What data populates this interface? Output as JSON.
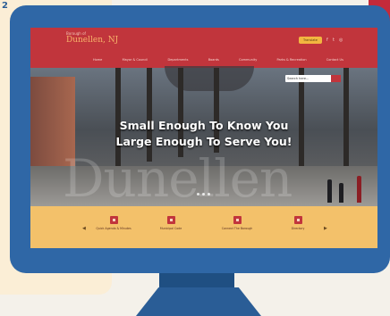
{
  "page_number": "2",
  "website": {
    "tagline": "Borough of",
    "title": "Dunellen, NJ",
    "translate_button": "Translate",
    "social_icons": [
      "facebook-icon",
      "twitter-icon",
      "instagram-icon"
    ],
    "nav_items": [
      "Home",
      "Mayor & Council",
      "Departments",
      "Boards",
      "Community",
      "Parks & Recreation",
      "Contact Us"
    ],
    "search_placeholder": "Search here...",
    "hero_line1": "Small Enough To Know You",
    "hero_line2": "Large Enough To Serve You!",
    "hero_watermark": "Dunellen",
    "quick_links": [
      {
        "label": "Quick Agenda & Minutes",
        "icon": "document-icon"
      },
      {
        "label": "Municipal Code",
        "icon": "book-icon"
      },
      {
        "label": "Connect The Borough",
        "icon": "chat-icon"
      },
      {
        "label": "Directory",
        "icon": "people-icon"
      }
    ],
    "prev_arrow": "◀",
    "next_arrow": "▶"
  },
  "colors": {
    "monitor_blue": "#2f67a6",
    "header_red": "#c1353c",
    "quick_links_yellow": "#f3c16a",
    "translate_gold": "#f2b640"
  }
}
